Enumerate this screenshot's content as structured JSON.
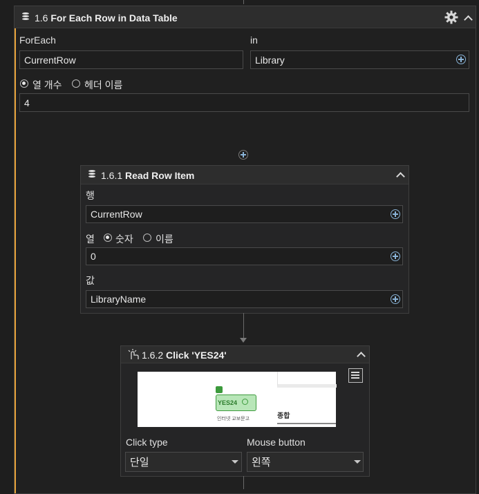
{
  "for_each": {
    "step": "1.6",
    "title": "For Each Row in Data Table",
    "foreach_label": "ForEach",
    "foreach_value": "CurrentRow",
    "in_label": "in",
    "in_value": "Library",
    "radio_count_label": "열 개수",
    "radio_header_label": "헤더 이름",
    "count_value": "4"
  },
  "read_row": {
    "step": "1.6.1",
    "title": "Read Row Item",
    "row_label": "행",
    "row_value": "CurrentRow",
    "col_label": "열",
    "radio_number_label": "숫자",
    "radio_name_label": "이름",
    "col_value": "0",
    "value_label": "값",
    "value_value": "LibraryName"
  },
  "click": {
    "step": "1.6.2",
    "title": "Click 'YES24'",
    "preview": {
      "yes24_label": "YES24",
      "caption": "인터넷 교보문고",
      "right_label": "종합"
    },
    "click_type_label": "Click type",
    "click_type_value": "단일",
    "mouse_button_label": "Mouse button",
    "mouse_button_value": "왼쪽"
  },
  "colors": {
    "accent_foreach": "#e8a33a",
    "accent_read": "#e8a33a",
    "accent_click": "#e86a4a",
    "target_green": "#3c9a3c"
  }
}
